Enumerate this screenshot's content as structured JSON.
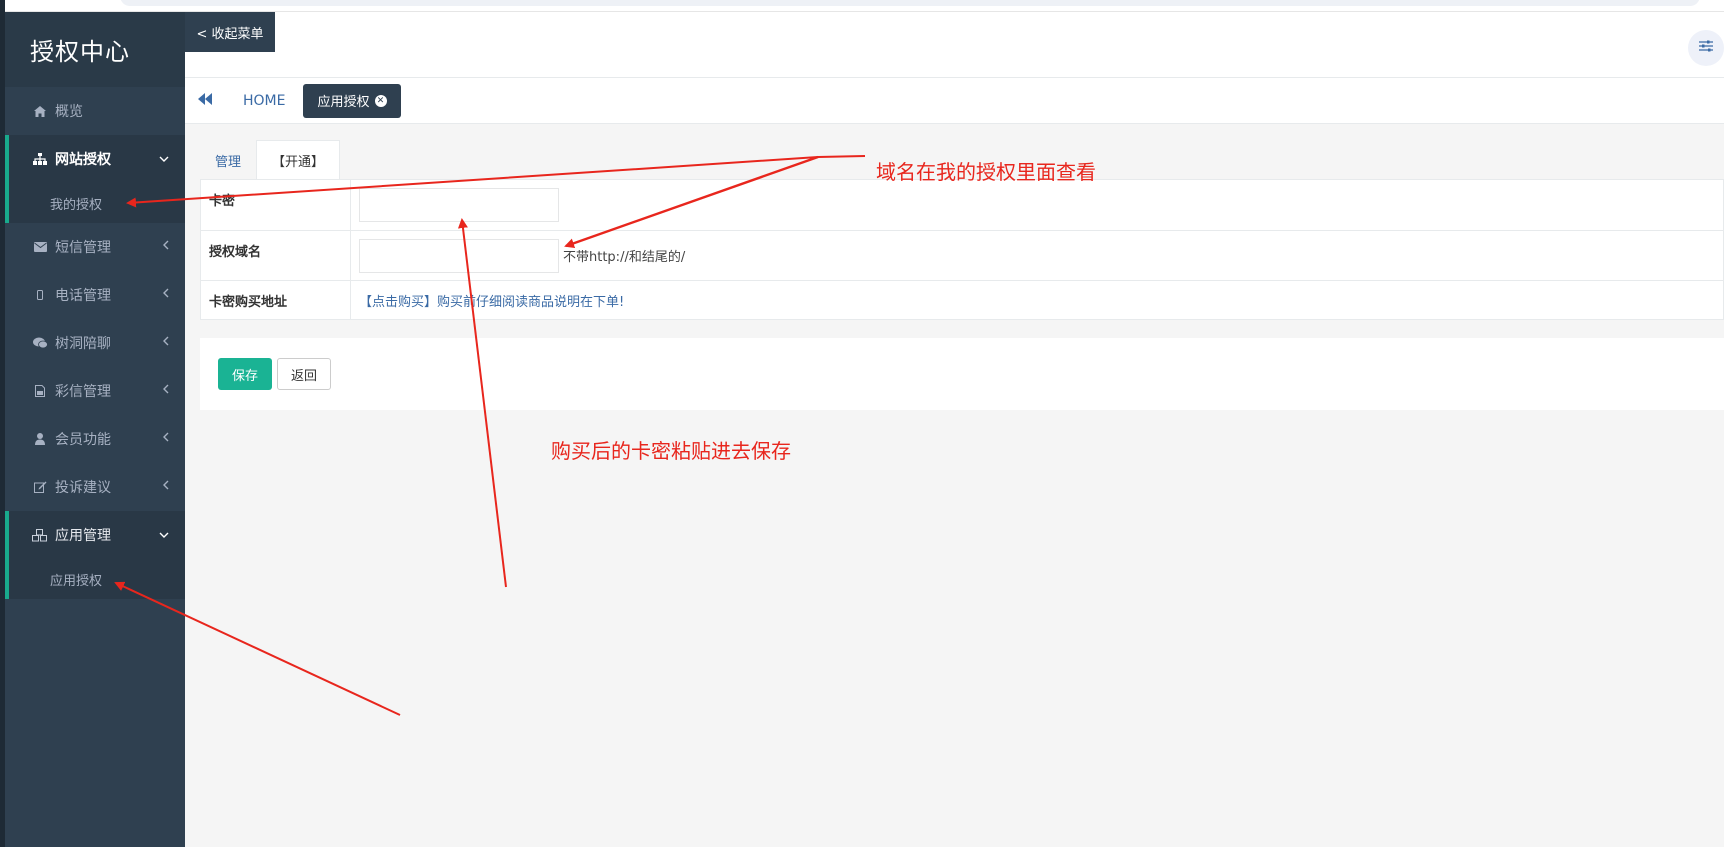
{
  "sidebar": {
    "brand": "授权中心",
    "items": [
      {
        "label": "概览",
        "icon": "home-icon"
      },
      {
        "label": "网站授权",
        "icon": "sitemap-icon",
        "expanded": true,
        "children": [
          {
            "label": "我的授权"
          }
        ]
      },
      {
        "label": "短信管理",
        "icon": "envelope-icon"
      },
      {
        "label": "电话管理",
        "icon": "mobile-icon"
      },
      {
        "label": "树洞陪聊",
        "icon": "wechat-icon"
      },
      {
        "label": "彩信管理",
        "icon": "file-image-icon"
      },
      {
        "label": "会员功能",
        "icon": "user-icon"
      },
      {
        "label": "投诉建议",
        "icon": "edit-icon"
      },
      {
        "label": "应用管理",
        "icon": "cubes-icon",
        "expanded": true,
        "children": [
          {
            "label": "应用授权"
          }
        ]
      }
    ]
  },
  "header": {
    "collapse_label": "< 收起菜单"
  },
  "tabs": {
    "home": "HOME",
    "active": "应用授权"
  },
  "content": {
    "subtabs": [
      "管理",
      "【开通】"
    ],
    "form": {
      "card_label": "卡密",
      "card_value": "",
      "domain_label": "授权域名",
      "domain_value": "",
      "domain_hint": "不带http://和结尾的/",
      "buy_label": "卡密购买地址",
      "buy_link": "【点击购买】购买前仔细阅读商品说明在下单!"
    },
    "buttons": {
      "save": "保存",
      "back": "返回"
    }
  },
  "annotations": {
    "note1": "域名在我的授权里面查看",
    "note2": "购买后的卡密粘贴进去保存"
  },
  "colors": {
    "sidebar_bg": "#2f4050",
    "accent": "#1ab394",
    "link": "#3a6aa5",
    "annotation": "#e8261d"
  }
}
